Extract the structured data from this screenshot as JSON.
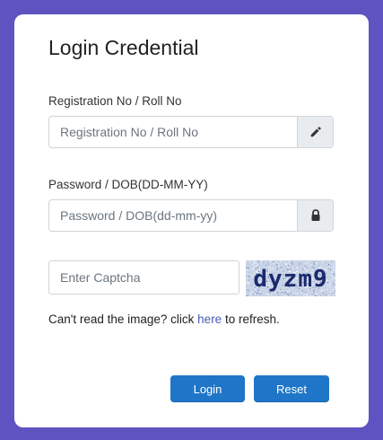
{
  "form": {
    "title": "Login Credential",
    "registration": {
      "label": "Registration No / Roll No",
      "placeholder": "Registration No / Roll No",
      "value": "",
      "icon": "pencil-icon"
    },
    "password": {
      "label": "Password / DOB(DD-MM-YY)",
      "placeholder": "Password / DOB(dd-mm-yy)",
      "value": "",
      "icon": "lock-icon"
    },
    "captcha": {
      "placeholder": "Enter Captcha",
      "value": "",
      "image_text": "dyzm9"
    },
    "refresh": {
      "prefix": "Can't read the image? click ",
      "link": "here",
      "suffix": " to refresh."
    },
    "buttons": {
      "login": "Login",
      "reset": "Reset"
    }
  },
  "colors": {
    "background": "#5f53c2",
    "card": "#ffffff",
    "button": "#1f76c8",
    "link": "#4a5bb5",
    "captcha_text": "#1a2a6e"
  }
}
